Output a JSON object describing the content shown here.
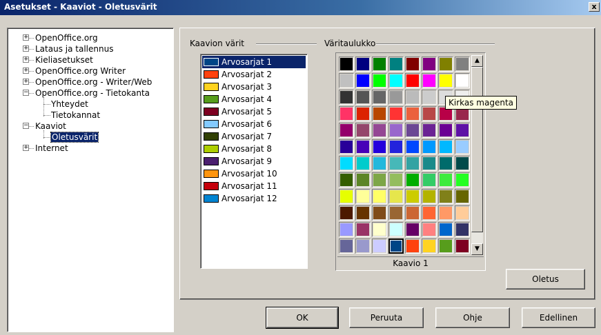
{
  "window": {
    "title": "Asetukset - Kaaviot - Oletusvärit",
    "close_glyph": "x"
  },
  "tree": {
    "nodes": [
      {
        "label": "OpenOffice.org",
        "expander": "+",
        "level": 0
      },
      {
        "label": "Lataus ja tallennus",
        "expander": "+",
        "level": 0
      },
      {
        "label": "Kieliasetukset",
        "expander": "+",
        "level": 0
      },
      {
        "label": "OpenOffice.org Writer",
        "expander": "+",
        "level": 0
      },
      {
        "label": "OpenOffice.org - Writer/Web",
        "expander": "+",
        "level": 0
      },
      {
        "label": "OpenOffice.org - Tietokanta",
        "expander": "−",
        "level": 0
      },
      {
        "label": "Yhteydet",
        "expander": "",
        "level": 1
      },
      {
        "label": "Tietokannat",
        "expander": "",
        "level": 1
      },
      {
        "label": "Kaaviot",
        "expander": "−",
        "level": 0
      },
      {
        "label": "Oletusvärit",
        "expander": "",
        "level": 1,
        "selected": true
      },
      {
        "label": "Internet",
        "expander": "+",
        "level": 0
      }
    ]
  },
  "chart_colors": {
    "group_label": "Kaavion värit",
    "series": [
      {
        "label": "Arvosarjat 1",
        "color": "#004586"
      },
      {
        "label": "Arvosarjat 2",
        "color": "#ff420e"
      },
      {
        "label": "Arvosarjat 3",
        "color": "#ffd320"
      },
      {
        "label": "Arvosarjat 4",
        "color": "#579d1c"
      },
      {
        "label": "Arvosarjat 5",
        "color": "#7e0021"
      },
      {
        "label": "Arvosarjat 6",
        "color": "#83caff"
      },
      {
        "label": "Arvosarjat 7",
        "color": "#314004"
      },
      {
        "label": "Arvosarjat 8",
        "color": "#aecf00"
      },
      {
        "label": "Arvosarjat 9",
        "color": "#4b1f6f"
      },
      {
        "label": "Arvosarjat 10",
        "color": "#ff950e"
      },
      {
        "label": "Arvosarjat 11",
        "color": "#c5000b"
      },
      {
        "label": "Arvosarjat 12",
        "color": "#0084d1"
      }
    ]
  },
  "palette": {
    "group_label": "Väritaulukko",
    "selected_name": "Kaavio 1",
    "tooltip": "Kirkas magenta",
    "rows": [
      [
        "#000000",
        "#000080",
        "#008000",
        "#008080",
        "#800000",
        "#800080",
        "#808000",
        "#808080"
      ],
      [
        "#c0c0c0",
        "#0000ff",
        "#00ff00",
        "#00ffff",
        "#ff0000",
        "#ff00ff",
        "#ffff00",
        "#ffffff"
      ],
      [
        "#333333",
        "#555555",
        "#666666",
        "#999999",
        "#bbbbbb",
        "#cccccc",
        "#dddddd",
        "#eeeeee"
      ],
      [
        "#ff3366",
        "#dc2300",
        "#b84700",
        "#ff3333",
        "#eb613d",
        "#b84747",
        "#b80047",
        "#99284c"
      ],
      [
        "#94006b",
        "#94476b",
        "#944794",
        "#9966cc",
        "#6b4794",
        "#6b2394",
        "#6b0094",
        "#5e11a6"
      ],
      [
        "#280099",
        "#4700b8",
        "#2300dc",
        "#2323dc",
        "#0047ff",
        "#0099ff",
        "#00b8ff",
        "#99ccff"
      ],
      [
        "#00dcff",
        "#00cccc",
        "#23b8dc",
        "#47b8b8",
        "#33a3a3",
        "#198a8a",
        "#006b6b",
        "#004a4a"
      ],
      [
        "#355e00",
        "#5c8526",
        "#7da647",
        "#94bd5e",
        "#00ae00",
        "#33cc66",
        "#3deb3d",
        "#23ff23"
      ],
      [
        "#e6ff00",
        "#ffff99",
        "#ffff66",
        "#e6e64c",
        "#cccc00",
        "#b3b300",
        "#808019",
        "#666600"
      ],
      [
        "#4c1900",
        "#663300",
        "#804c19",
        "#996633",
        "#cc6633",
        "#ff6633",
        "#ff9966",
        "#ffcc99"
      ],
      [
        "#9999ff",
        "#993366",
        "#ffffcc",
        "#ccffff",
        "#660066",
        "#ff8080",
        "#0066cc",
        "#333366"
      ],
      [
        "#666699",
        "#9999cc",
        "#ccccff",
        "#004586",
        "#ff420e",
        "#ffd320",
        "#579d1c",
        "#7e0021"
      ]
    ],
    "selected_cell": {
      "row": 11,
      "col": 3
    }
  },
  "buttons": {
    "default_label": "Oletus",
    "ok": "OK",
    "cancel": "Peruuta",
    "help": "Ohje",
    "back": "Edellinen"
  }
}
